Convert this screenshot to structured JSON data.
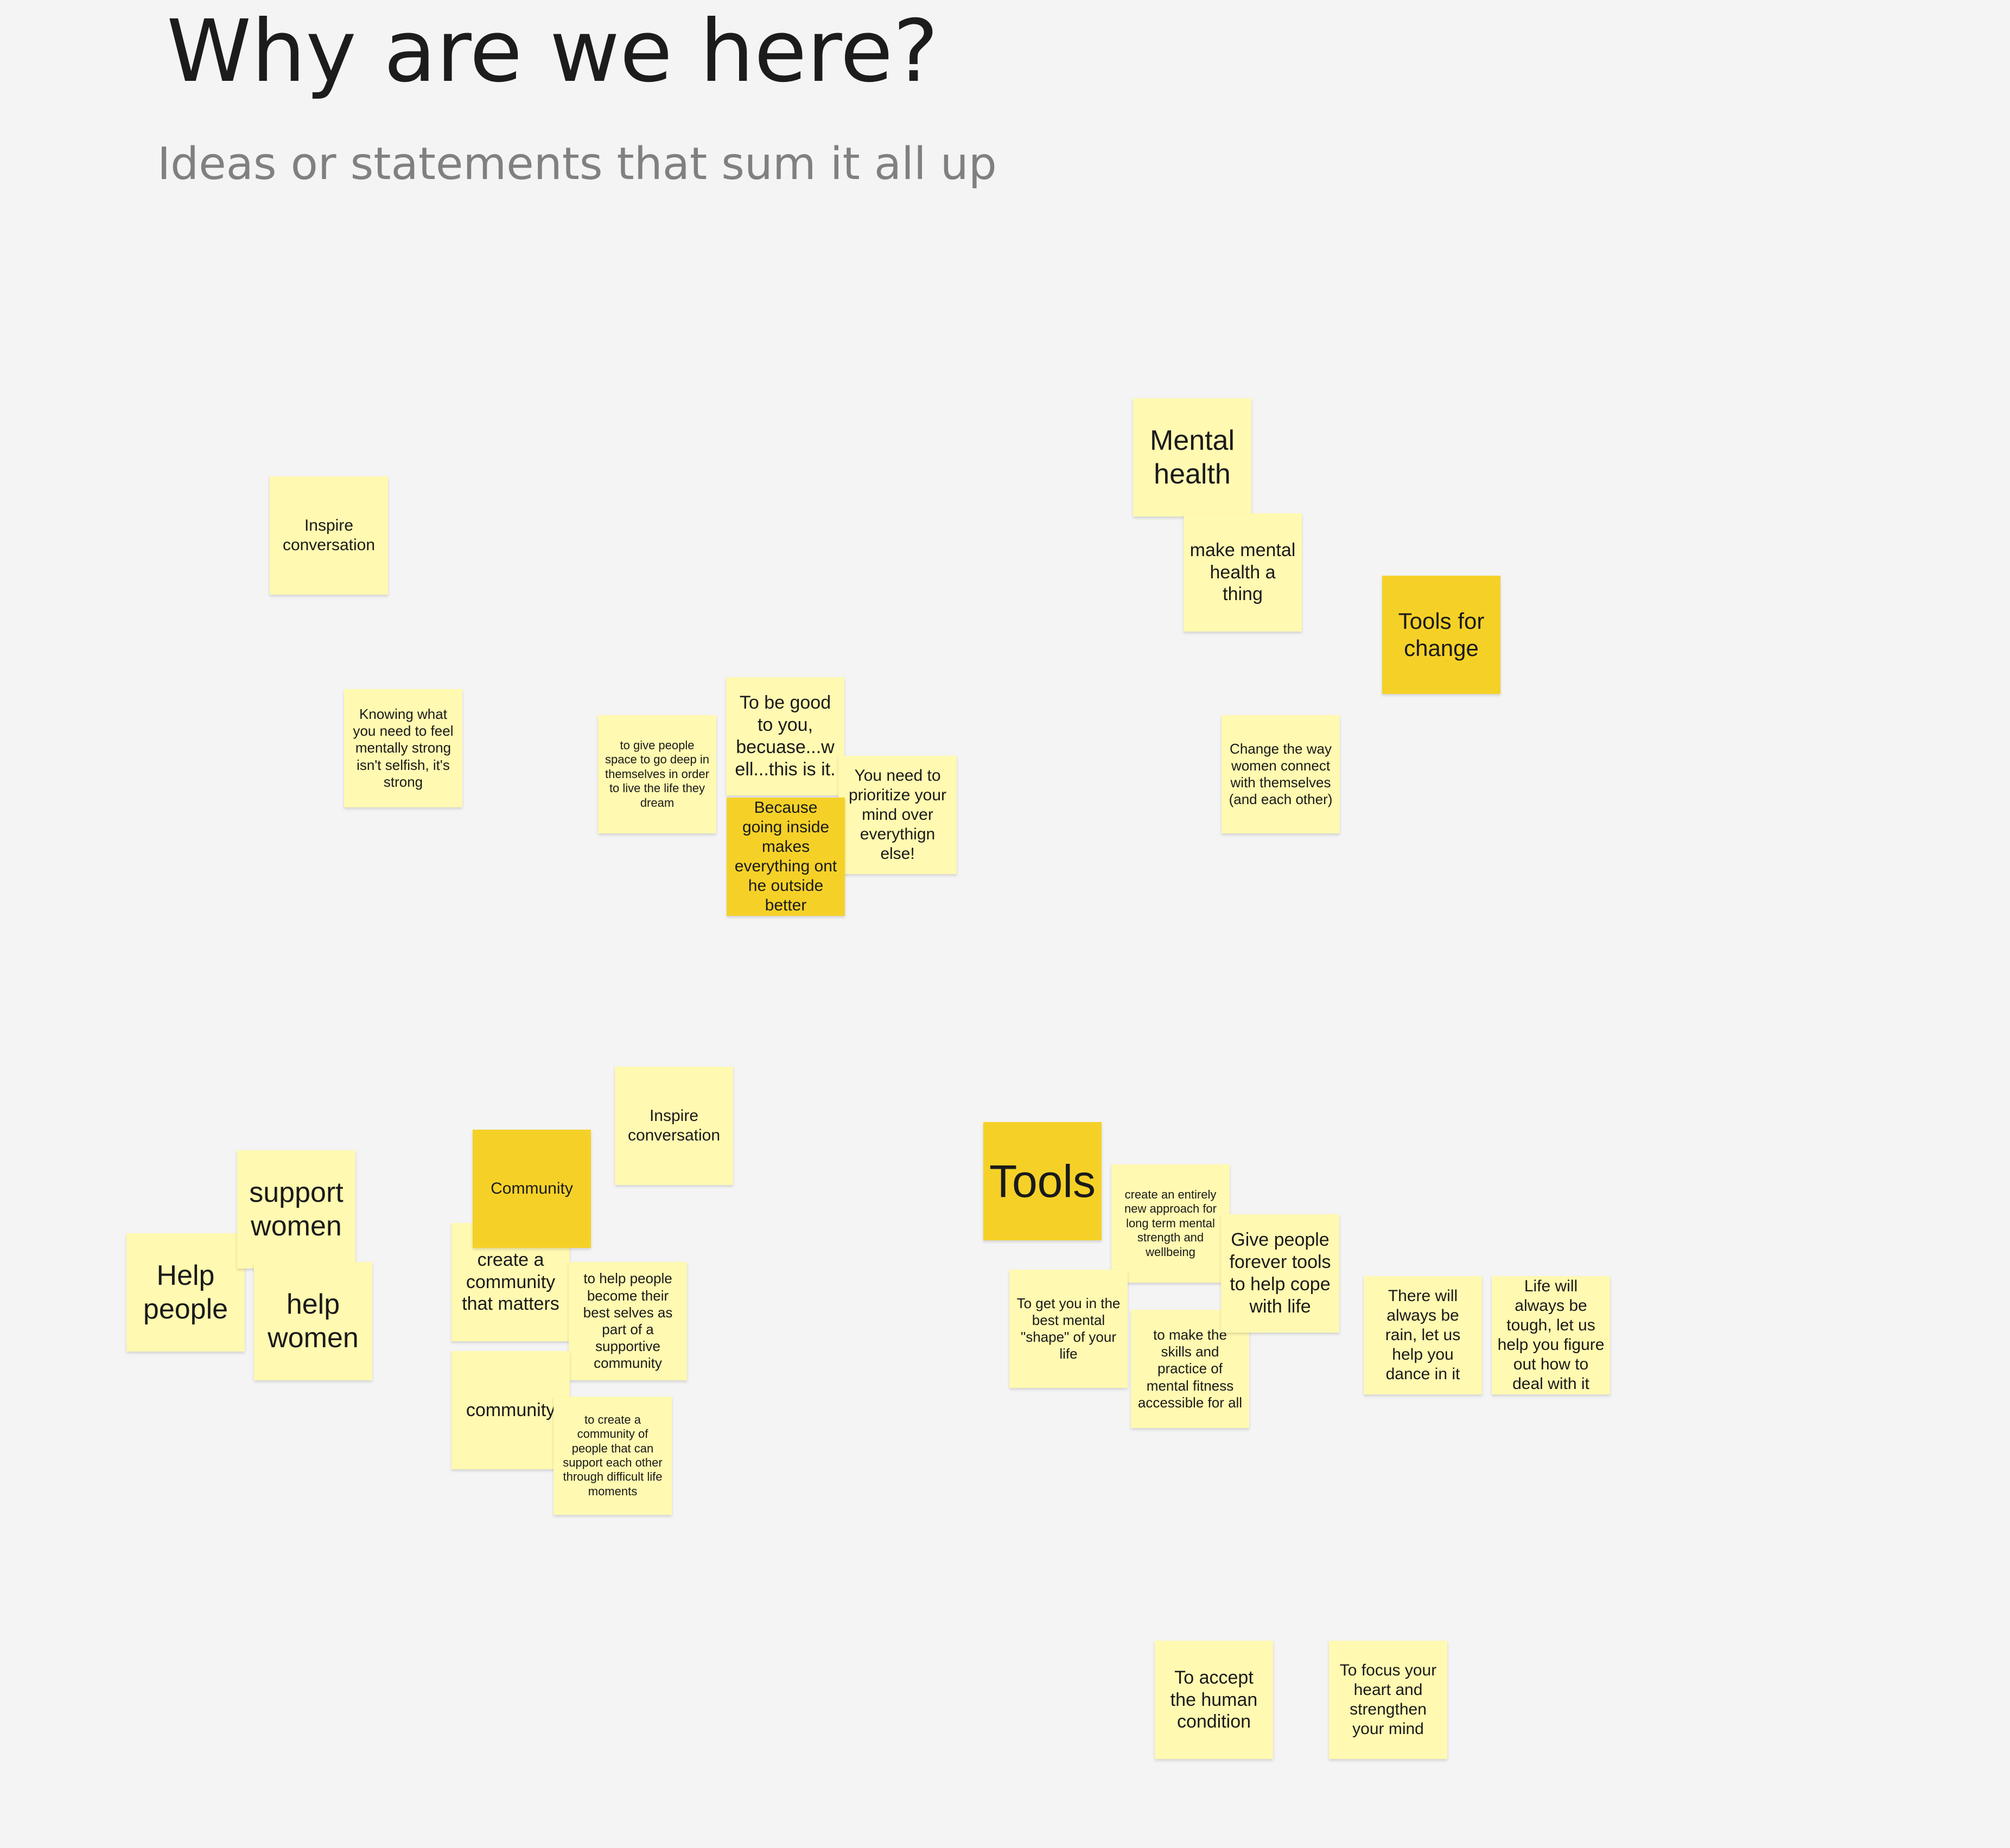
{
  "board": {
    "title": "Why are we here?",
    "subtitle": "Ideas or statements that sum it all up"
  },
  "notes": {
    "inspire_conversation_1": "Inspire conversation",
    "knowing_what_you_need": "Knowing what you need to feel mentally strong isn't selfish, it's strong",
    "give_people_space": "to give people space to go deep in themselves in order to live the life they dream",
    "to_be_good_to_you": "To be good to you, becuase...w ell...this is it.",
    "because_going_inside": "Because going inside makes everything ont he outside better",
    "prioritize_your_mind": "You need to prioritize your mind over everythign else!",
    "mental_health": "Mental health",
    "make_mental_health": "make mental health a thing",
    "tools_for_change": "Tools for change",
    "change_the_way": "Change the way women connect with themselves (and each other)",
    "inspire_conversation_2": "Inspire conversation",
    "support_women": "support women",
    "help_people": "Help people",
    "help_women": "help women",
    "community_header": "Community",
    "create_community": "create a community that matters",
    "help_people_become": "to help people become their best selves as part of a supportive community",
    "community": "community",
    "create_community_support": "to create a community of people that can support each other through   difficult life moments",
    "tools": "Tools",
    "create_approach": "create an entirely new approach for long term mental strength and wellbeing",
    "give_people_tools": "Give people forever tools to help cope with life",
    "best_mental_shape": "To get you in the best mental \"shape\" of your life",
    "mental_fitness": "to make the skills and practice of mental fitness accessible for all",
    "always_be_rain": "There will always be rain, let us help you dance in it",
    "life_always_tough": "Life will always be tough, let us help you figure out how to deal with it",
    "accept_human_condition": "To accept the human condition",
    "focus_your_heart": "To focus your heart and strengthen your mind"
  },
  "colors": {
    "background": "#f4f4f4",
    "sticky_light_yellow": "#fff9b1",
    "sticky_dark_yellow": "#f5d128",
    "title_text": "#1c1c1c",
    "subtitle_text": "#808080"
  }
}
